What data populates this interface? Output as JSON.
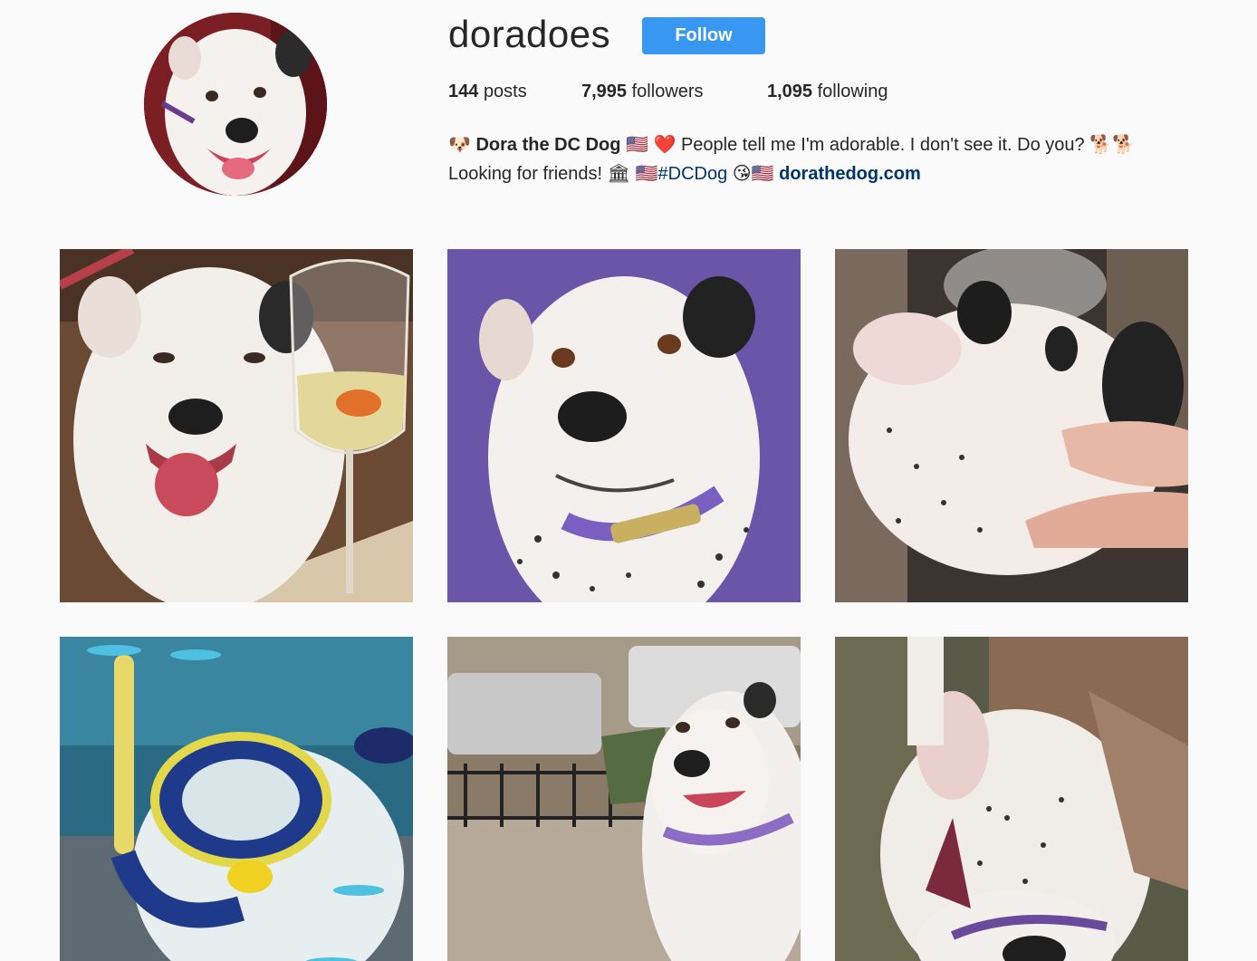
{
  "profile": {
    "username": "doradoes",
    "follow_label": "Follow",
    "stats": {
      "posts_count": "144",
      "posts_label": "posts",
      "followers_count": "7,995",
      "followers_label": "followers",
      "following_count": "1,095",
      "following_label": "following"
    },
    "bio": {
      "line1_emoji": "🐶",
      "name": "Dora the DC Dog",
      "line1_emoji2": "🇺🇸 ❤️",
      "line1_text": "People tell me I'm adorable. I don't see it. Do you?",
      "line1_emoji3": "🐕🐕",
      "line2_text": "Looking for friends!",
      "line2_emoji": "🏛 🇺🇸",
      "hashtag": "#DCDog",
      "line2_emoji2": "😘🇺🇸",
      "link": "dorathedog.com"
    },
    "avatar_icon": "dog-avatar"
  },
  "posts": [
    {
      "id": "post-1",
      "icon": "dog-with-wine-photo"
    },
    {
      "id": "post-2",
      "icon": "dog-purple-wall-photo"
    },
    {
      "id": "post-3",
      "icon": "dog-belly-rub-photo"
    },
    {
      "id": "post-4",
      "icon": "dog-snorkel-photo"
    },
    {
      "id": "post-5",
      "icon": "dog-street-photo"
    },
    {
      "id": "post-6",
      "icon": "dog-upside-down-photo"
    }
  ],
  "colors": {
    "follow_button": "#3897f0",
    "link": "#003569",
    "background": "#fafafa"
  }
}
